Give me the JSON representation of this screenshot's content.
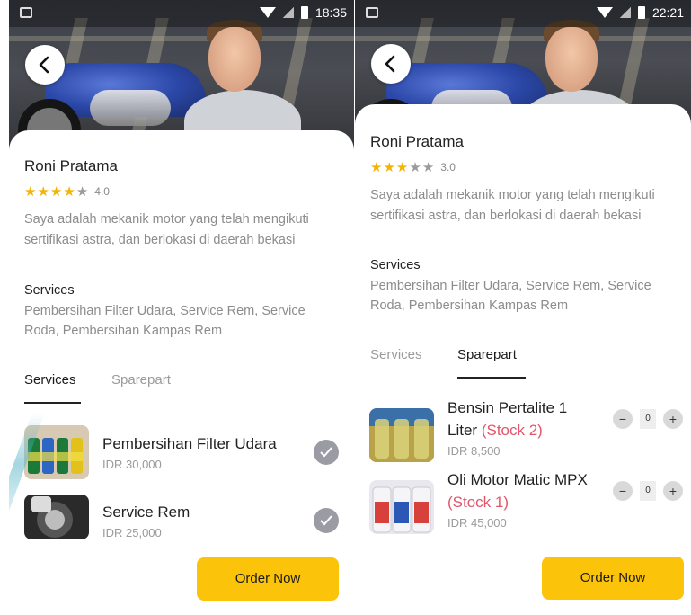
{
  "screens": [
    {
      "status_time": "18:35",
      "mechanic": {
        "name": "Roni Pratama",
        "rating_value": "4.0",
        "stars_filled": 4,
        "description": "Saya adalah mekanik motor yang telah mengikuti sertifikasi astra, dan berlokasi di daerah bekasi",
        "services_title": "Services",
        "services_list": "Pembersihan Filter Udara, Service Rem, Service Roda, Pembersihan Kampas Rem"
      },
      "tabs": [
        {
          "label": "Services",
          "active": true
        },
        {
          "label": "Sparepart",
          "active": false
        }
      ],
      "items": [
        {
          "title": "Pembersihan Filter Udara",
          "price": "IDR 30,000",
          "icon": "check-icon"
        },
        {
          "title": "Service Rem",
          "price": "IDR 25,000",
          "icon": "check-icon"
        }
      ],
      "order_label": "Order Now"
    },
    {
      "status_time": "22:21",
      "mechanic": {
        "name": "Roni Pratama",
        "rating_value": "3.0",
        "stars_filled": 3,
        "description": "Saya adalah mekanik motor yang telah mengikuti sertifikasi astra, dan berlokasi di daerah bekasi",
        "services_title": "Services",
        "services_list": "Pembersihan Filter Udara, Service Rem, Service Roda, Pembersihan Kampas Rem"
      },
      "tabs": [
        {
          "label": "Services",
          "active": false
        },
        {
          "label": "Sparepart",
          "active": true
        }
      ],
      "items": [
        {
          "title_line1": "Bensin Pertalite 1",
          "title_line2": "Liter",
          "stock": "(Stock 2)",
          "price": "IDR 8,500",
          "qty": "0"
        },
        {
          "title_line1": "Oli Motor Matic MPX",
          "stock": "(Stock 1)",
          "price": "IDR 45,000",
          "qty": "0"
        }
      ],
      "qty_minus": "−",
      "qty_plus": "+",
      "order_label": "Order Now"
    }
  ],
  "colors": {
    "accent": "#fbc40a",
    "star": "#f5b400",
    "stock": "#e0566b",
    "muted_text": "#8c8c8c"
  }
}
